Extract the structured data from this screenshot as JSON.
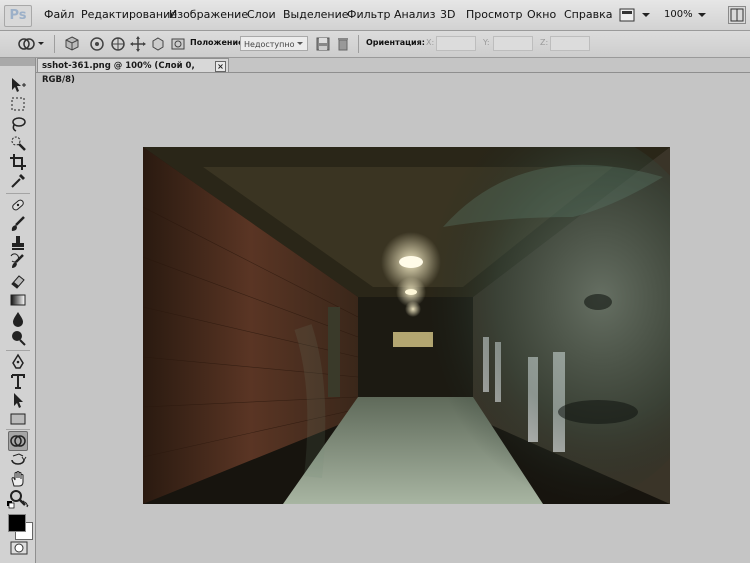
{
  "app": {
    "logo": "Ps"
  },
  "menu": [
    "Файл",
    "Редактирование",
    "Изображение",
    "Слои",
    "Выделение",
    "Фильтр",
    "Анализ",
    "3D",
    "Просмотр",
    "Окно",
    "Справка"
  ],
  "menubar_right": {
    "zoom": "100%",
    "view_icon": "screen-mode-icon"
  },
  "options": {
    "position_label": "Положение:",
    "position_value": "Недоступно",
    "orientation_label": "Ориентация:",
    "x_label": "X:",
    "y_label": "Y:",
    "z_label": "Z:"
  },
  "document": {
    "tab_title": "sshot-361.png @ 100% (Слой 0, RGB/8)",
    "close": "×"
  },
  "colors": {
    "foreground": "#000000",
    "background": "#ffffff",
    "ui_bg": "#c5c5c5"
  },
  "tools": [
    "move-icon",
    "marquee-icon",
    "lasso-icon",
    "quick-selection-icon",
    "crop-icon",
    "eyedropper-icon",
    "healing-brush-icon",
    "brush-icon",
    "clone-stamp-icon",
    "history-brush-icon",
    "eraser-icon",
    "gradient-icon",
    "blur-icon",
    "dodge-icon",
    "pen-icon",
    "type-icon",
    "path-selection-icon",
    "rectangle-icon",
    "3d-rotate-icon",
    "3d-orbit-icon",
    "hand-icon",
    "zoom-icon"
  ]
}
